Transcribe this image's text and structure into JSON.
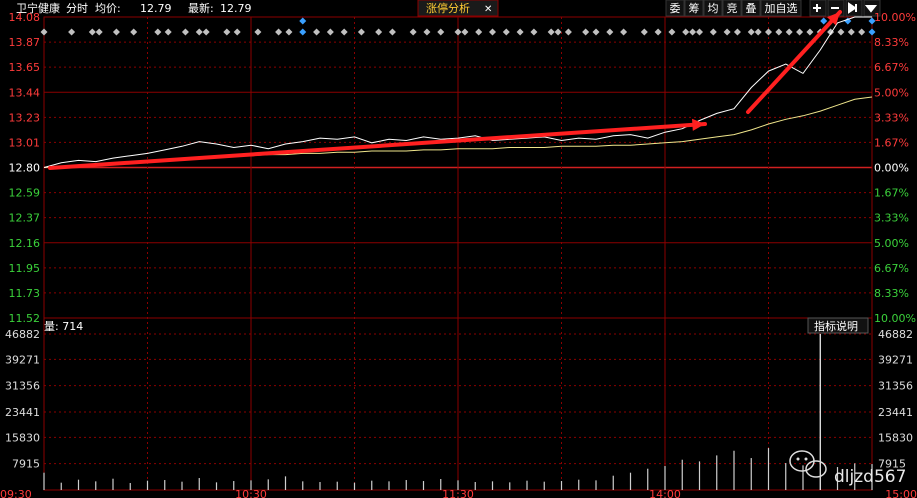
{
  "header": {
    "stock_name": "卫宁健康",
    "mode": "分时",
    "avg_label": "均价:",
    "avg_value": "12.79",
    "last_label": "最新:",
    "last_value": "12.79",
    "tab_label": "涨停分析",
    "tab_close": "✕",
    "toolbar": [
      "委",
      "筹",
      "均",
      "竞",
      "叠",
      "加自选"
    ],
    "toolbar_icons": [
      "plus-icon",
      "minus-icon",
      "skip-end-icon",
      "dropdown-icon"
    ]
  },
  "volume_panel": {
    "label": "量: 714",
    "indicator_button": "指标说明"
  },
  "watermark": {
    "text": "dljzd567",
    "icon": "wechat-icon"
  },
  "colors": {
    "up": "#ff3b3b",
    "down": "#3bd13b",
    "price_line": "#ffffff",
    "avg_line": "#f0e68c",
    "grid": "#8b0000",
    "arrow": "#ff2020",
    "event_marker": "#c0c0c0",
    "event_marker_highlight": "#3aa0ff"
  },
  "chart_data": [
    {
      "type": "line",
      "title": "",
      "x_ticks": [
        "09:30",
        "10:30",
        "11:30",
        "14:00",
        "15:00"
      ],
      "y_left_ticks": [
        "14.08",
        "13.87",
        "13.65",
        "13.44",
        "13.23",
        "13.01",
        "12.80",
        "12.59",
        "12.37",
        "12.16",
        "11.95",
        "11.73",
        "11.52"
      ],
      "y_right_ticks": [
        "10.00%",
        "8.33%",
        "6.67%",
        "5.00%",
        "3.33%",
        "1.67%",
        "0.00%",
        "1.67%",
        "3.33%",
        "5.00%",
        "6.67%",
        "8.33%",
        "10.00%"
      ],
      "ylim": [
        11.52,
        14.08
      ],
      "prev_close": 12.8,
      "grid": true,
      "x_minutes": [
        0,
        5,
        10,
        15,
        20,
        25,
        30,
        35,
        40,
        45,
        50,
        55,
        60,
        65,
        70,
        75,
        80,
        85,
        90,
        95,
        100,
        105,
        110,
        115,
        120,
        125,
        130,
        135,
        140,
        145,
        150,
        155,
        160,
        165,
        170,
        175,
        180,
        185,
        190,
        195,
        200,
        205,
        210,
        215,
        220,
        225,
        230,
        235,
        240
      ],
      "series": [
        {
          "values": [
            12.8,
            12.84,
            12.86,
            12.85,
            12.88,
            12.9,
            12.92,
            12.95,
            12.98,
            13.02,
            13.0,
            12.97,
            12.99,
            12.96,
            13.0,
            13.02,
            13.05,
            13.04,
            13.06,
            13.01,
            13.04,
            13.03,
            13.06,
            13.04,
            13.05,
            13.07,
            13.03,
            13.04,
            13.05,
            13.06,
            13.03,
            13.05,
            13.04,
            13.07,
            13.08,
            13.05,
            13.1,
            13.13,
            13.2,
            13.26,
            13.3,
            13.48,
            13.62,
            13.68,
            13.6,
            13.8,
            14.03,
            14.08,
            14.08
          ]
        },
        {
          "values": [
            12.8,
            12.81,
            12.82,
            12.83,
            12.84,
            12.85,
            12.86,
            12.87,
            12.88,
            12.89,
            12.89,
            12.9,
            12.9,
            12.91,
            12.91,
            12.92,
            12.92,
            12.93,
            12.93,
            12.94,
            12.94,
            12.94,
            12.95,
            12.95,
            12.96,
            12.96,
            12.96,
            12.97,
            12.97,
            12.97,
            12.98,
            12.98,
            12.98,
            12.99,
            12.99,
            13.0,
            13.01,
            13.02,
            13.04,
            13.06,
            13.08,
            13.12,
            13.17,
            13.21,
            13.24,
            13.28,
            13.33,
            13.38,
            13.4
          ]
        }
      ],
      "event_markers": [
        0,
        8,
        14,
        16,
        21,
        26,
        33,
        36,
        41,
        45,
        47,
        53,
        56,
        62,
        68,
        71,
        75,
        79,
        83,
        87,
        92,
        97,
        101,
        107,
        111,
        115,
        120,
        122,
        126,
        130,
        134,
        138,
        142,
        147,
        149,
        152,
        157,
        160,
        164,
        168,
        174,
        178,
        182,
        186,
        188,
        190,
        194,
        198,
        201,
        205,
        207,
        210,
        213,
        216,
        219,
        222,
        225,
        228,
        231,
        234,
        237,
        240
      ],
      "highlight_markers": [
        75,
        226,
        233,
        240
      ]
    },
    {
      "type": "bar",
      "title": "",
      "yticks": [
        "46882",
        "39271",
        "31356",
        "23441",
        "15830",
        "7915"
      ],
      "ylim": [
        0,
        46882
      ],
      "x_minutes": [
        0,
        5,
        10,
        15,
        20,
        25,
        30,
        35,
        40,
        45,
        50,
        55,
        60,
        65,
        70,
        75,
        80,
        85,
        90,
        95,
        100,
        105,
        110,
        115,
        120,
        125,
        130,
        135,
        140,
        145,
        150,
        155,
        160,
        165,
        170,
        175,
        180,
        185,
        190,
        195,
        200,
        205,
        210,
        215,
        220,
        225,
        230,
        235,
        240
      ],
      "values": [
        5200,
        2200,
        3100,
        2600,
        3400,
        2100,
        2800,
        3000,
        2500,
        3600,
        2300,
        2700,
        2900,
        3200,
        4100,
        2600,
        2400,
        2500,
        2200,
        2800,
        2600,
        3000,
        2700,
        3300,
        2900,
        2400,
        2600,
        2300,
        2800,
        2500,
        2700,
        3100,
        2900,
        4300,
        5200,
        6400,
        7200,
        9100,
        8600,
        10400,
        11800,
        9600,
        12600,
        8100,
        7400,
        46882,
        6900,
        8000,
        7800
      ]
    }
  ]
}
